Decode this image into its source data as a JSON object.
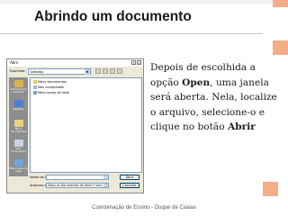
{
  "slide": {
    "title": "Abrindo um documento",
    "body_pre": "Depois de escolhida a opção ",
    "body_bold1": "Open",
    "body_mid": ", uma janela será aberta. Nela, localize o arquivo, selecione-o e clique no botão ",
    "body_bold2": "Abrir",
    "footer": "Coordenação de Ensino - Duque de Caxias"
  },
  "dialog": {
    "title": "Abrir",
    "lookin_label": "Examinar:",
    "lookin_value": "Desktop",
    "places": [
      {
        "label": "Documentos recentes",
        "icon": "recent-docs-icon"
      },
      {
        "label": "Desktop",
        "icon": "desktop-icon"
      },
      {
        "label": "Meus documentos",
        "icon": "my-documents-icon"
      },
      {
        "label": "Meu computador",
        "icon": "my-computer-icon"
      },
      {
        "label": "Meus locais de rede",
        "icon": "network-places-icon"
      }
    ],
    "files": [
      "Meus documentos",
      "Meu computador",
      "Meus locais de rede"
    ],
    "filename_label": "Nome do arquivo:",
    "filename_value": "",
    "filetype_label": "Arquivos do tipo:",
    "filetype_value": "Todos os Documentos do Word (*.doc)",
    "open_button": "Abrir",
    "cancel_button": "Cancelar"
  },
  "colors": {
    "accent": "#f4ad87",
    "places_bar": "#8e8e8e",
    "dialog_bg": "#ece9d8"
  }
}
